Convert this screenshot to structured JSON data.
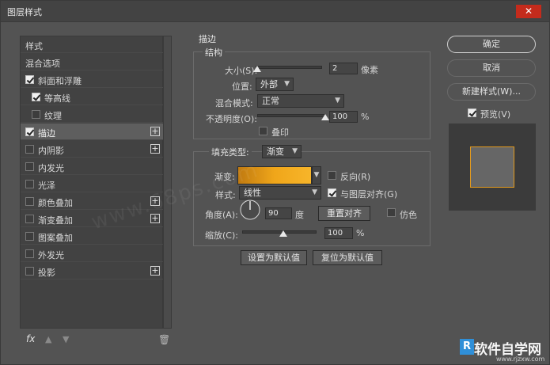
{
  "window": {
    "title": "图层样式",
    "close_label": "✕"
  },
  "left_panel": {
    "items": [
      {
        "label": "样式",
        "checkbox": "none",
        "plus": false,
        "indent": 0,
        "selected": false
      },
      {
        "label": "混合选项",
        "checkbox": "none",
        "plus": false,
        "indent": 0,
        "selected": false
      },
      {
        "label": "斜面和浮雕",
        "checkbox": "on",
        "plus": false,
        "indent": 0,
        "selected": false
      },
      {
        "label": "等高线",
        "checkbox": "on",
        "plus": false,
        "indent": 1,
        "selected": false
      },
      {
        "label": "纹理",
        "checkbox": "off",
        "plus": false,
        "indent": 1,
        "selected": false
      },
      {
        "label": "描边",
        "checkbox": "on",
        "plus": true,
        "indent": 0,
        "selected": true
      },
      {
        "label": "内阴影",
        "checkbox": "off",
        "plus": true,
        "indent": 0,
        "selected": false
      },
      {
        "label": "内发光",
        "checkbox": "off",
        "plus": false,
        "indent": 0,
        "selected": false
      },
      {
        "label": "光泽",
        "checkbox": "off",
        "plus": false,
        "indent": 0,
        "selected": false
      },
      {
        "label": "颜色叠加",
        "checkbox": "off",
        "plus": true,
        "indent": 0,
        "selected": false
      },
      {
        "label": "渐变叠加",
        "checkbox": "off",
        "plus": true,
        "indent": 0,
        "selected": false
      },
      {
        "label": "图案叠加",
        "checkbox": "off",
        "plus": false,
        "indent": 0,
        "selected": false
      },
      {
        "label": "外发光",
        "checkbox": "off",
        "plus": false,
        "indent": 0,
        "selected": false
      },
      {
        "label": "投影",
        "checkbox": "off",
        "plus": true,
        "indent": 0,
        "selected": false
      }
    ],
    "fx_label": "fx",
    "up_label": "▲",
    "down_label": "▼",
    "trash_label": "🗑"
  },
  "stroke": {
    "section_title": "描边",
    "structure_title": "结构",
    "size_label": "大小(S):",
    "size_value": "2",
    "size_unit": "像素",
    "size_level": 0.02,
    "position_label": "位置:",
    "position_value": "外部",
    "blend_label": "混合模式:",
    "blend_value": "正常",
    "opacity_label": "不透明度(O):",
    "opacity_value": "100",
    "opacity_unit": "%",
    "opacity_level": 1.0,
    "overprint_label": "叠印",
    "overprint_checked": false
  },
  "fill": {
    "fill_type_label": "填充类型:",
    "fill_type_value": "渐变",
    "gradient_label": "渐变:",
    "gradient_colors": [
      "#c07a10",
      "#f0a61a",
      "#f7b52a"
    ],
    "reverse_label": "反向(R)",
    "reverse_checked": false,
    "style_label": "样式:",
    "style_value": "线性",
    "align_label": "与图层对齐(G)",
    "align_checked": true,
    "angle_label": "角度(A):",
    "angle_value": "90",
    "angle_unit": "度",
    "reset_align_label": "重置对齐",
    "dither_label": "仿色",
    "dither_checked": false,
    "scale_label": "缩放(C):",
    "scale_value": "100",
    "scale_unit": "%",
    "scale_level": 1.0
  },
  "bottom_buttons": {
    "set_default": "设置为默认值",
    "reset_default": "复位为默认值"
  },
  "right_panel": {
    "ok": "确定",
    "cancel": "取消",
    "new_style": "新建样式(W)...",
    "preview_label": "预览(V)",
    "preview_checked": true,
    "preview_stroke_color": "#e39a1d"
  },
  "watermark": "www.68ps.com",
  "logo": {
    "text": "软件自学网",
    "url": "www.rjzxw.com",
    "mark": "R"
  },
  "colors": {
    "accent": "#e39a1d",
    "panel": "#535353",
    "close": "#c42b1c"
  }
}
